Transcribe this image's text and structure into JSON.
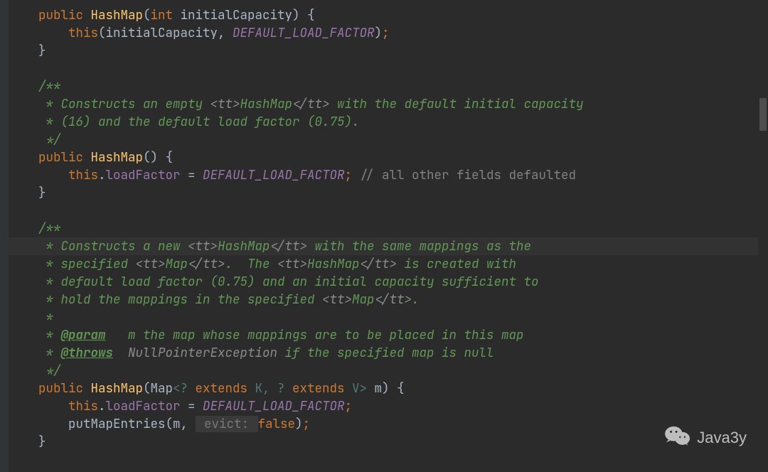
{
  "file": "HashMap.java",
  "watermark": {
    "label": "Java3y"
  },
  "highlighted_line_index": 13,
  "lines": [
    {
      "indent": 1,
      "tokens": [
        {
          "t": "public ",
          "c": "kw"
        },
        {
          "t": "HashMap",
          "c": "mname"
        },
        {
          "t": "(",
          "c": "paren"
        },
        {
          "t": "int ",
          "c": "kw"
        },
        {
          "t": "initialCapacity",
          "c": "pn"
        },
        {
          "t": ") {",
          "c": "paren"
        }
      ]
    },
    {
      "indent": 2,
      "tokens": [
        {
          "t": "this",
          "c": "kw"
        },
        {
          "t": "(initialCapacity, ",
          "c": "pn"
        },
        {
          "t": "DEFAULT_LOAD_FACTOR",
          "c": "const"
        },
        {
          "t": ")",
          "c": "paren"
        },
        {
          "t": ";",
          "c": "semi"
        }
      ]
    },
    {
      "indent": 1,
      "tokens": [
        {
          "t": "}",
          "c": "brace"
        }
      ]
    },
    {
      "indent": 0,
      "tokens": [
        {
          "t": "",
          "c": "pn"
        }
      ]
    },
    {
      "indent": 1,
      "tokens": [
        {
          "t": "/**",
          "c": "cmt"
        }
      ]
    },
    {
      "indent": 1,
      "tokens": [
        {
          "t": " * Constructs an empty ",
          "c": "cmt"
        },
        {
          "t": "<tt>",
          "c": "doctype"
        },
        {
          "t": "HashMap",
          "c": "cmt"
        },
        {
          "t": "</tt>",
          "c": "doctype"
        },
        {
          "t": " with the default initial capacity",
          "c": "cmt"
        }
      ]
    },
    {
      "indent": 1,
      "tokens": [
        {
          "t": " * (16) and the default load factor (0.75).",
          "c": "cmt"
        }
      ]
    },
    {
      "indent": 1,
      "tokens": [
        {
          "t": " */",
          "c": "cmt"
        }
      ]
    },
    {
      "indent": 1,
      "tokens": [
        {
          "t": "public ",
          "c": "kw"
        },
        {
          "t": "HashMap",
          "c": "mname"
        },
        {
          "t": "() {",
          "c": "paren"
        }
      ]
    },
    {
      "indent": 2,
      "tokens": [
        {
          "t": "this",
          "c": "kw"
        },
        {
          "t": ".",
          "c": "pn"
        },
        {
          "t": "loadFactor",
          "c": "fld"
        },
        {
          "t": " = ",
          "c": "pn"
        },
        {
          "t": "DEFAULT_LOAD_FACTOR",
          "c": "const"
        },
        {
          "t": ";",
          "c": "semi"
        },
        {
          "t": " // all other fields defaulted",
          "c": "cmt-line"
        }
      ]
    },
    {
      "indent": 1,
      "tokens": [
        {
          "t": "}",
          "c": "brace"
        }
      ]
    },
    {
      "indent": 0,
      "tokens": [
        {
          "t": "",
          "c": "pn"
        }
      ]
    },
    {
      "indent": 1,
      "tokens": [
        {
          "t": "/**",
          "c": "cmt"
        }
      ]
    },
    {
      "indent": 1,
      "tokens": [
        {
          "t": " * Constructs a new ",
          "c": "cmt"
        },
        {
          "t": "<tt>",
          "c": "doctype"
        },
        {
          "t": "HashMap",
          "c": "cmt"
        },
        {
          "t": "</tt>",
          "c": "doctype"
        },
        {
          "t": " with the same mappings as the",
          "c": "cmt"
        }
      ]
    },
    {
      "indent": 1,
      "tokens": [
        {
          "t": " * specified ",
          "c": "cmt"
        },
        {
          "t": "<tt>",
          "c": "doctype"
        },
        {
          "t": "Map",
          "c": "cmt"
        },
        {
          "t": "</tt>",
          "c": "doctype"
        },
        {
          "t": ".  The ",
          "c": "cmt"
        },
        {
          "t": "<tt>",
          "c": "doctype"
        },
        {
          "t": "HashMap",
          "c": "cmt"
        },
        {
          "t": "</tt>",
          "c": "doctype"
        },
        {
          "t": " is created with",
          "c": "cmt"
        }
      ]
    },
    {
      "indent": 1,
      "tokens": [
        {
          "t": " * default load factor (0.75) and an initial capacity sufficient to",
          "c": "cmt"
        }
      ]
    },
    {
      "indent": 1,
      "tokens": [
        {
          "t": " * hold the mappings in the specified ",
          "c": "cmt"
        },
        {
          "t": "<tt>",
          "c": "doctype"
        },
        {
          "t": "Map",
          "c": "cmt"
        },
        {
          "t": "</tt>",
          "c": "doctype"
        },
        {
          "t": ".",
          "c": "cmt"
        }
      ]
    },
    {
      "indent": 1,
      "tokens": [
        {
          "t": " *",
          "c": "cmt"
        }
      ]
    },
    {
      "indent": 1,
      "tokens": [
        {
          "t": " * ",
          "c": "cmt"
        },
        {
          "t": "@param",
          "c": "tag"
        },
        {
          "t": "   m the map whose mappings are to be placed in this map",
          "c": "cmt"
        }
      ]
    },
    {
      "indent": 1,
      "tokens": [
        {
          "t": " * ",
          "c": "cmt"
        },
        {
          "t": "@throws",
          "c": "tag"
        },
        {
          "t": "  ",
          "c": "cmt"
        },
        {
          "t": "NullPointerException",
          "c": "doctype"
        },
        {
          "t": " if the specified map is null",
          "c": "cmt"
        }
      ]
    },
    {
      "indent": 1,
      "tokens": [
        {
          "t": " */",
          "c": "cmt"
        }
      ]
    },
    {
      "indent": 1,
      "tokens": [
        {
          "t": "public ",
          "c": "kw"
        },
        {
          "t": "HashMap",
          "c": "mname"
        },
        {
          "t": "(",
          "c": "paren"
        },
        {
          "t": "Map",
          "c": "pn"
        },
        {
          "t": "<? ",
          "c": "generic"
        },
        {
          "t": "extends ",
          "c": "kw"
        },
        {
          "t": "K",
          "c": "generic"
        },
        {
          "t": ", ? ",
          "c": "generic"
        },
        {
          "t": "extends ",
          "c": "kw"
        },
        {
          "t": "V",
          "c": "generic"
        },
        {
          "t": "> ",
          "c": "generic"
        },
        {
          "t": "m",
          "c": "pn"
        },
        {
          "t": ") {",
          "c": "paren"
        }
      ]
    },
    {
      "indent": 2,
      "tokens": [
        {
          "t": "this",
          "c": "kw"
        },
        {
          "t": ".",
          "c": "pn"
        },
        {
          "t": "loadFactor",
          "c": "fld"
        },
        {
          "t": " = ",
          "c": "pn"
        },
        {
          "t": "DEFAULT_LOAD_FACTOR",
          "c": "const"
        },
        {
          "t": ";",
          "c": "semi"
        }
      ]
    },
    {
      "indent": 2,
      "tokens": [
        {
          "t": "putMapEntries(m, ",
          "c": "pn"
        },
        {
          "t": " evict: ",
          "c": "hint"
        },
        {
          "t": "false",
          "c": "kw"
        },
        {
          "t": ")",
          "c": "paren"
        },
        {
          "t": ";",
          "c": "semi"
        }
      ]
    },
    {
      "indent": 1,
      "tokens": [
        {
          "t": "}",
          "c": "brace"
        }
      ]
    }
  ]
}
